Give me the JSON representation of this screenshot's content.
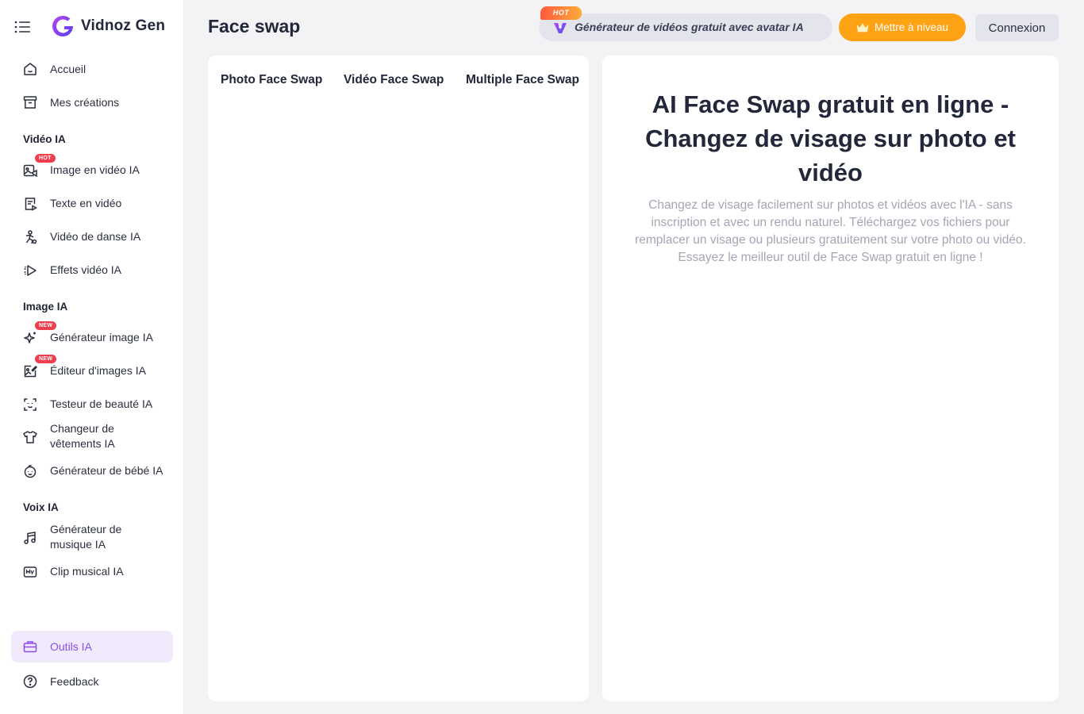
{
  "brand": {
    "name": "Vidnoz Gen"
  },
  "sidebar": {
    "items": [
      {
        "label": "Accueil"
      },
      {
        "label": "Mes créations"
      }
    ],
    "sections": [
      {
        "title": "Vidéo IA",
        "items": [
          {
            "label": "Image en vidéo IA",
            "badge": "HOT"
          },
          {
            "label": "Texte en vidéo"
          },
          {
            "label": "Vidéo de danse IA"
          },
          {
            "label": "Effets vidéo IA"
          }
        ]
      },
      {
        "title": "Image IA",
        "items": [
          {
            "label": "Générateur image IA",
            "badge": "NEW"
          },
          {
            "label": "Éditeur d'images IA",
            "badge": "NEW"
          },
          {
            "label": "Testeur de beauté IA"
          },
          {
            "label_line1": "Changeur de",
            "label_line2": "vêtements IA"
          },
          {
            "label": "Générateur de bébé IA"
          }
        ]
      },
      {
        "title": "Voix IA",
        "items": [
          {
            "label_line1": "Générateur de",
            "label_line2": "musique IA"
          },
          {
            "label": "Clip musical IA"
          }
        ]
      }
    ],
    "bottom": [
      {
        "label": "Outils IA",
        "active": true
      },
      {
        "label": "Feedback"
      }
    ]
  },
  "header": {
    "page_title": "Face swap",
    "promo": {
      "hot": "HOT",
      "text": "Générateur de vidéos gratuit avec avatar IA"
    },
    "upgrade_label": "Mettre à niveau",
    "login_label": "Connexion"
  },
  "tabs": [
    {
      "label": "Photo Face Swap"
    },
    {
      "label": "Vidéo Face Swap"
    },
    {
      "label": "Multiple Face Swap"
    }
  ],
  "hero": {
    "title": "AI Face Swap gratuit en ligne - Changez de visage sur photo et vidéo",
    "description": "Changez de visage facilement sur photos et vidéos avec l'IA - sans inscription et avec un rendu naturel. Téléchargez vos fichiers pour remplacer un visage ou plusieurs gratuitement sur votre photo ou vidéo. Essayez le meilleur outil de Face Swap gratuit en ligne !"
  },
  "colors": {
    "accent": "#8a4dea",
    "upgrade": "#ffa314",
    "badge": "#ef3f4f",
    "background": "#f3f3f6"
  }
}
